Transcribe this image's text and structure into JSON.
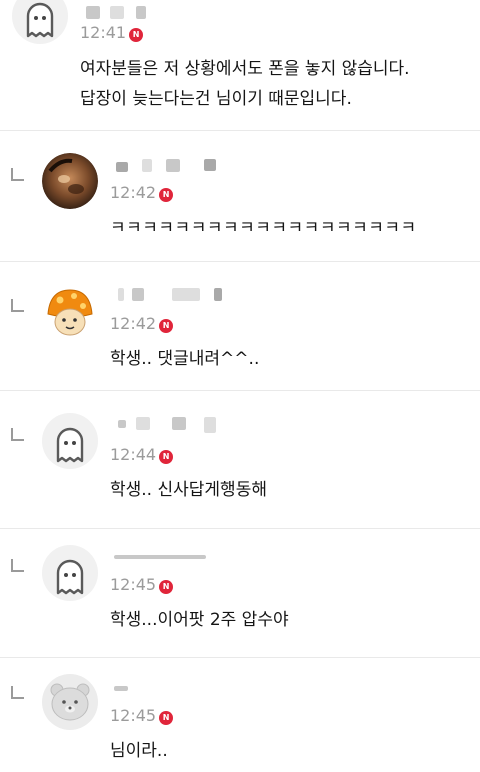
{
  "comments": [
    {
      "time": "12:41",
      "badge": "N",
      "lines": [
        "여자분들은 저 상황에서도 폰을 놓지 않습니다.",
        "답장이 늦는다는건 님이기 때문입니다."
      ],
      "is_reply": false,
      "avatar": "ghost-avatar-icon"
    },
    {
      "time": "12:42",
      "badge": "N",
      "lines": [
        "ㅋㅋㅋㅋㅋㅋㅋㅋㅋㅋㅋㅋㅋㅋㅋㅋㅋㅋㅋ"
      ],
      "is_reply": true,
      "avatar": "photo-avatar"
    },
    {
      "time": "12:42",
      "badge": "N",
      "lines": [
        "학생.. 댓글내려^^.."
      ],
      "is_reply": true,
      "avatar": "mushroom-avatar-icon"
    },
    {
      "time": "12:44",
      "badge": "N",
      "lines": [
        "학생.. 신사답게행동해"
      ],
      "is_reply": true,
      "avatar": "ghost-avatar-icon"
    },
    {
      "time": "12:45",
      "badge": "N",
      "lines": [
        "학생...이어팟 2주 압수야"
      ],
      "is_reply": true,
      "avatar": "ghost-avatar-icon"
    },
    {
      "time": "12:45",
      "badge": "N",
      "lines": [
        "님이라.."
      ],
      "is_reply": true,
      "avatar": "bear-avatar-icon"
    }
  ],
  "colors": {
    "badge": "#e0253a",
    "timestamp": "#9b9b9b",
    "divider": "#e9e9e9",
    "text": "#151515"
  }
}
